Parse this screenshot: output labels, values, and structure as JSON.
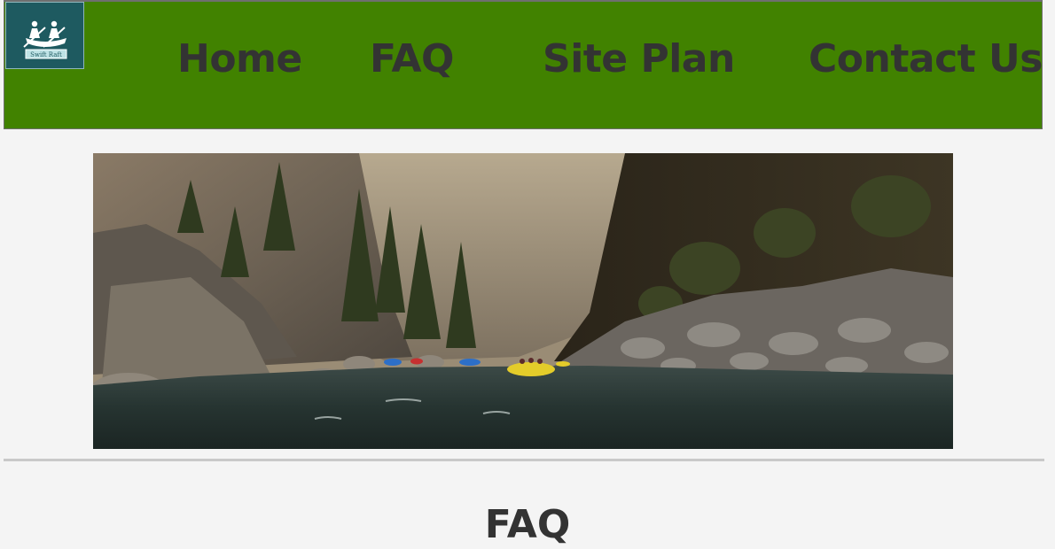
{
  "header": {
    "logo": {
      "text": "Swift Raft",
      "icon": "raft-paddlers-icon",
      "background": "#1e5a60"
    },
    "nav": {
      "home": "Home",
      "faq": "FAQ",
      "site_plan": "Site Plan",
      "contact": "Contact Us"
    },
    "background": "#418200",
    "text_color": "#333333"
  },
  "hero": {
    "image": "river-canyon-rafting-photo"
  },
  "main": {
    "section_title": "FAQ"
  }
}
